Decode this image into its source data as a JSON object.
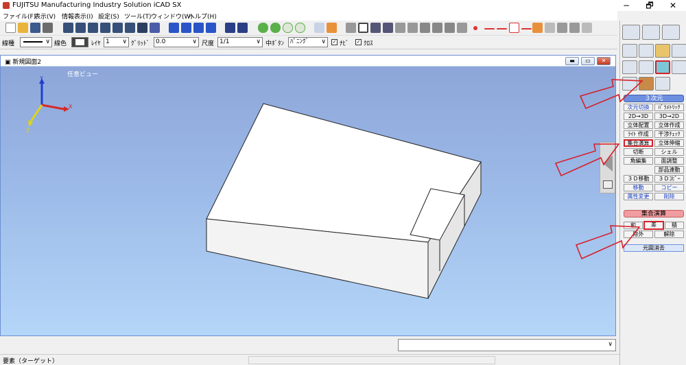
{
  "window": {
    "title": "FUJITSU Manufacturing Industry Solution iCAD SX",
    "minimize": "−",
    "restore": "🗗",
    "close": "✕"
  },
  "menu": [
    "ファイル(F)",
    "表示(V)",
    "情報表示(I)",
    "設定(S)",
    "ツール(T)",
    "ウィンドウ(W)",
    "ヘルプ(H)"
  ],
  "toolbar2": {
    "line_type_label": "線種",
    "line_color_label": "線色",
    "layer_label": "ﾚｲﾔ",
    "layer_value": "1",
    "grid_label": "ｸﾞﾘｯﾄﾞ",
    "grid_value": "0.0",
    "scale_label": "尺度",
    "scale_value": "1/1",
    "middle_button_label": "中ﾎﾞﾀﾝ",
    "middle_button_value": "ﾊﾟﾆﾝｸﾞ",
    "check1_label": "ﾅﾋﾞ",
    "check2_label": "ｸﾛｽ"
  },
  "document": {
    "title": "新規図面2",
    "view_label": "任意ビュー",
    "axis_x": "X",
    "axis_y": "Y",
    "axis_z": "Z"
  },
  "status": {
    "element_label": "要素（ターゲット）"
  },
  "right_panel": {
    "header_3d": "３次元",
    "buttons_3d": [
      [
        "次元切換",
        "ﾊﾟﾗﾒﾄﾘｯｸ"
      ],
      [
        "2D→3D",
        "3D→2D"
      ],
      [
        "立体配置",
        "立体作成"
      ],
      [
        "ﾗｲﾄ 作成",
        "干渉ﾁｪｯｸ"
      ],
      [
        "集合演算",
        "立体伸縮"
      ],
      [
        "切断",
        "シェル"
      ],
      [
        "角編集",
        "面調整"
      ],
      [
        "",
        "部品連動"
      ],
      [
        "３Ｄ移動",
        "３Ｄｺﾋﾟｰ"
      ],
      [
        "移動",
        "コピー"
      ],
      [
        "属性変更",
        "削除"
      ]
    ],
    "header_set": "集合演算",
    "set_ops": [
      "和",
      "差",
      "積"
    ],
    "set_ops2": [
      "除外",
      "解除"
    ],
    "restore_label": "元図消去"
  },
  "colors": {
    "accent_blue": "#6d8fe0",
    "header_pink": "#f19ca0",
    "highlight_red": "#d6202a"
  }
}
